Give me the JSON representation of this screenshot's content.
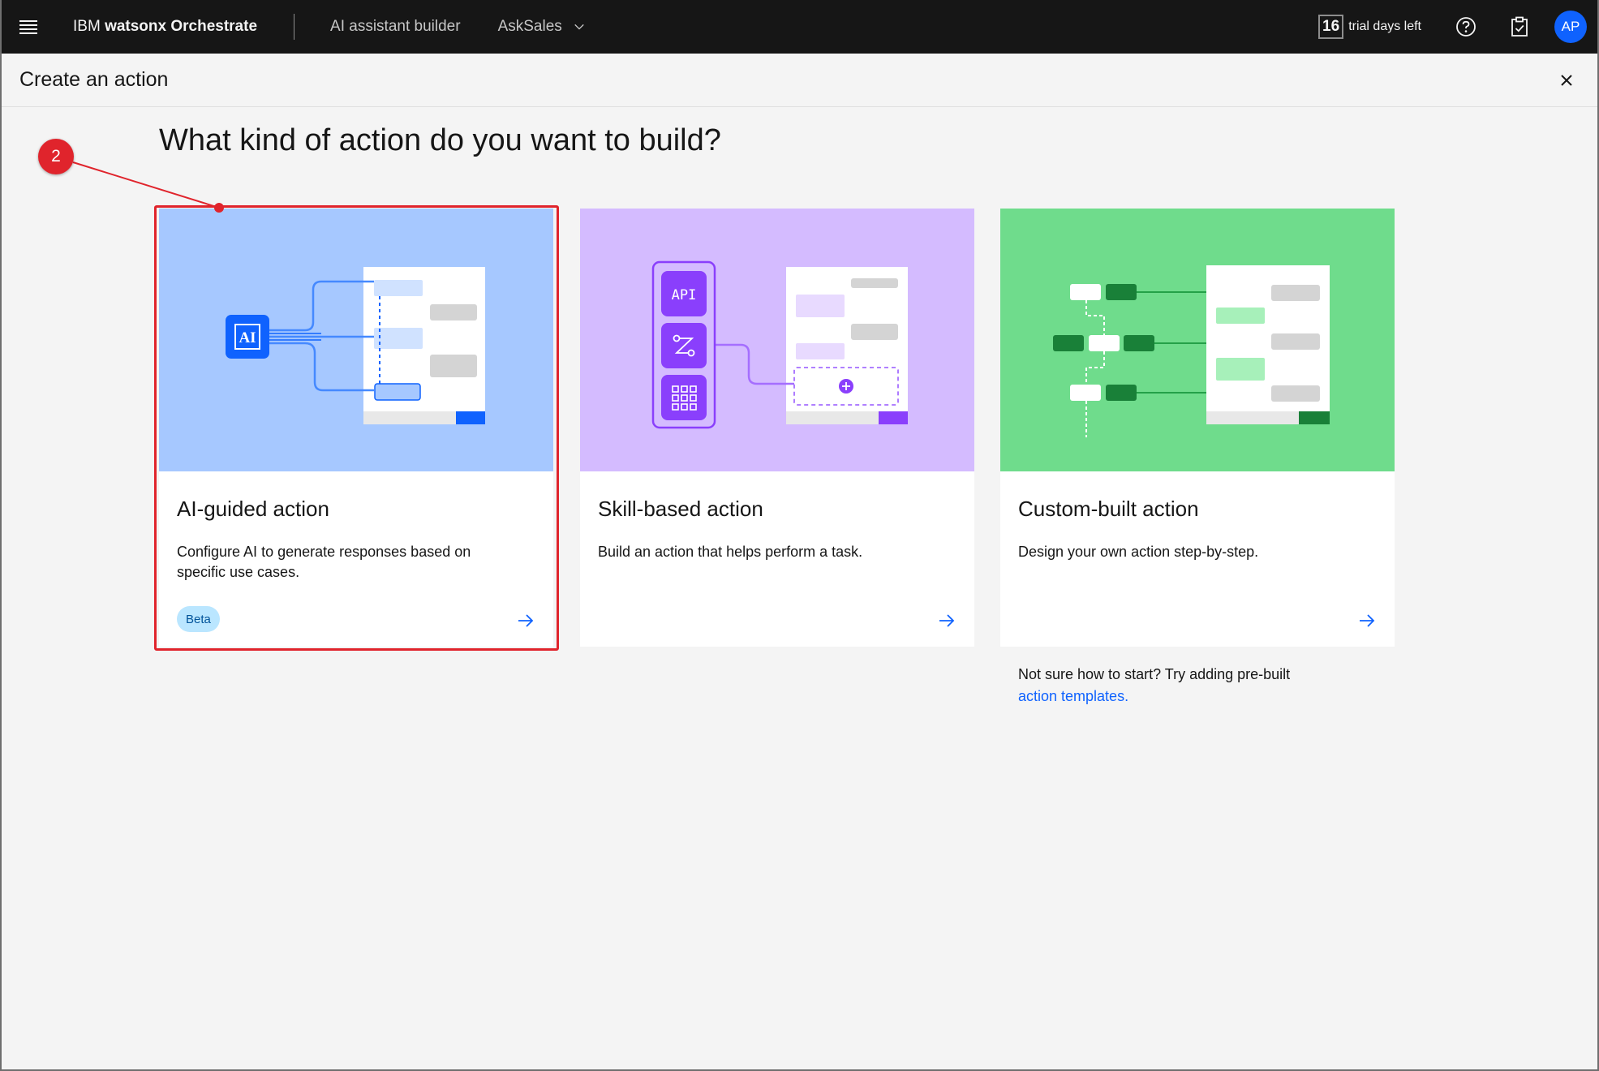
{
  "topbar": {
    "brand_prefix": "IBM",
    "brand_name": "watsonx Orchestrate",
    "nav_builder": "AI assistant builder",
    "nav_assistant": "AskSales",
    "trial_days": "16",
    "trial_text": "trial days left",
    "avatar_initials": "AP"
  },
  "header": {
    "title": "Create an action"
  },
  "main": {
    "question": "What kind of action do you want to build?",
    "cards": [
      {
        "title": "AI-guided action",
        "description": "Configure AI to generate responses based on specific use cases.",
        "badge": "Beta",
        "illus_label": "AI"
      },
      {
        "title": "Skill-based action",
        "description": "Build an action that helps perform a task.",
        "illus_label": "API"
      },
      {
        "title": "Custom-built action",
        "description": "Design your own action step-by-step."
      }
    ],
    "hint_text": "Not sure how to start? Try adding pre-built",
    "hint_link": "action templates."
  },
  "annotation": {
    "step_number": "2"
  },
  "colors": {
    "topbar_bg": "#161616",
    "accent_blue": "#0f62fe",
    "card1_bg": "#a6c8ff",
    "card2_bg": "#d4bbff",
    "card3_bg": "#6fdc8c",
    "highlight_red": "#e0242c"
  }
}
